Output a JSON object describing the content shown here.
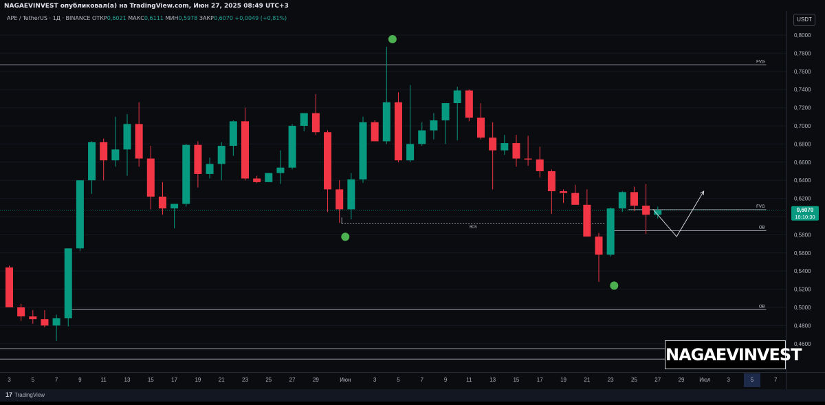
{
  "header": {
    "published_by": "NAGAEVINVEST опубликовал(а) на TradingView.com, Июн 27, 2025 08:49 UTC+3"
  },
  "symbol_line": {
    "title": "APE / TetherUS · 1Д · BINANCE",
    "open_label": "ОТКР",
    "open": "0,6021",
    "high_label": "МАКС",
    "high": "0,6111",
    "low_label": "МИН",
    "low": "0,5978",
    "close_label": "ЗАКР",
    "close": "0,6070",
    "change": "+0,0049 (+0,81%)"
  },
  "currency_button": "USDT",
  "price_badge": {
    "price": "0,6070",
    "timer": "18:10:30",
    "color": "#089981"
  },
  "watermark": "NAGAEVINVEST",
  "footer": {
    "brand_mark": "17",
    "brand": "TradingView"
  },
  "colors": {
    "up": "#089981",
    "down": "#f23645",
    "marker": "#4caf50",
    "background": "#0b0c10"
  },
  "chart_data": {
    "type": "candlestick",
    "ylim": [
      0.44,
      0.82
    ],
    "y_ticks": [
      0.46,
      0.48,
      0.5,
      0.52,
      0.54,
      0.56,
      0.58,
      0.6,
      0.62,
      0.64,
      0.66,
      0.68,
      0.7,
      0.72,
      0.74,
      0.76,
      0.78,
      0.8
    ],
    "y_tick_labels": [
      "0,4600",
      "0,4800",
      "0,5000",
      "0,5200",
      "0,5400",
      "0,5600",
      "0,5800",
      "0,6000",
      "0,6200",
      "0,6400",
      "0,6600",
      "0,6800",
      "0,7000",
      "0,7200",
      "0,7400",
      "0,7600",
      "0,7800",
      "0,8000"
    ],
    "x_tick_labels": [
      "3",
      "5",
      "7",
      "9",
      "11",
      "13",
      "15",
      "17",
      "19",
      "21",
      "23",
      "25",
      "27",
      "29",
      "Июн",
      "3",
      "5",
      "7",
      "9",
      "11",
      "13",
      "15",
      "17",
      "19",
      "21",
      "23",
      "25",
      "27",
      "29",
      "Июл",
      "3",
      "5",
      "7"
    ],
    "x_tick_index": [
      0,
      2,
      4,
      6,
      8,
      10,
      12,
      14,
      16,
      18,
      20,
      22,
      24,
      26,
      28.5,
      31,
      33,
      35,
      37,
      39,
      41,
      43,
      45,
      47,
      49,
      51,
      53,
      55,
      57,
      59,
      61,
      63,
      65
    ],
    "highlighted_x_label": "5",
    "candles": [
      {
        "o": 0.544,
        "h": 0.546,
        "l": 0.5,
        "c": 0.5
      },
      {
        "o": 0.5,
        "h": 0.504,
        "l": 0.485,
        "c": 0.49
      },
      {
        "o": 0.49,
        "h": 0.497,
        "l": 0.482,
        "c": 0.487
      },
      {
        "o": 0.487,
        "h": 0.497,
        "l": 0.478,
        "c": 0.48
      },
      {
        "o": 0.48,
        "h": 0.492,
        "l": 0.463,
        "c": 0.488
      },
      {
        "o": 0.488,
        "h": 0.505,
        "l": 0.479,
        "c": 0.565
      },
      {
        "o": 0.565,
        "h": 0.573,
        "l": 0.562,
        "c": 0.64
      },
      {
        "o": 0.64,
        "h": 0.683,
        "l": 0.625,
        "c": 0.682
      },
      {
        "o": 0.682,
        "h": 0.686,
        "l": 0.64,
        "c": 0.662
      },
      {
        "o": 0.662,
        "h": 0.71,
        "l": 0.655,
        "c": 0.674
      },
      {
        "o": 0.674,
        "h": 0.713,
        "l": 0.645,
        "c": 0.702
      },
      {
        "o": 0.702,
        "h": 0.726,
        "l": 0.655,
        "c": 0.664
      },
      {
        "o": 0.664,
        "h": 0.678,
        "l": 0.608,
        "c": 0.622
      },
      {
        "o": 0.622,
        "h": 0.638,
        "l": 0.602,
        "c": 0.609
      },
      {
        "o": 0.609,
        "h": 0.613,
        "l": 0.587,
        "c": 0.614
      },
      {
        "o": 0.614,
        "h": 0.68,
        "l": 0.611,
        "c": 0.679
      },
      {
        "o": 0.679,
        "h": 0.683,
        "l": 0.632,
        "c": 0.647
      },
      {
        "o": 0.647,
        "h": 0.665,
        "l": 0.642,
        "c": 0.658
      },
      {
        "o": 0.658,
        "h": 0.682,
        "l": 0.64,
        "c": 0.678
      },
      {
        "o": 0.678,
        "h": 0.706,
        "l": 0.667,
        "c": 0.705
      },
      {
        "o": 0.705,
        "h": 0.72,
        "l": 0.64,
        "c": 0.642
      },
      {
        "o": 0.642,
        "h": 0.645,
        "l": 0.637,
        "c": 0.638
      },
      {
        "o": 0.638,
        "h": 0.648,
        "l": 0.64,
        "c": 0.648
      },
      {
        "o": 0.648,
        "h": 0.673,
        "l": 0.636,
        "c": 0.654
      },
      {
        "o": 0.654,
        "h": 0.702,
        "l": 0.652,
        "c": 0.7
      },
      {
        "o": 0.7,
        "h": 0.713,
        "l": 0.694,
        "c": 0.714
      },
      {
        "o": 0.714,
        "h": 0.735,
        "l": 0.69,
        "c": 0.693
      },
      {
        "o": 0.693,
        "h": 0.695,
        "l": 0.605,
        "c": 0.63
      },
      {
        "o": 0.63,
        "h": 0.64,
        "l": 0.593,
        "c": 0.608
      },
      {
        "o": 0.608,
        "h": 0.648,
        "l": 0.597,
        "c": 0.641
      },
      {
        "o": 0.641,
        "h": 0.71,
        "l": 0.637,
        "c": 0.704
      },
      {
        "o": 0.704,
        "h": 0.706,
        "l": 0.687,
        "c": 0.683
      },
      {
        "o": 0.683,
        "h": 0.787,
        "l": 0.68,
        "c": 0.726
      },
      {
        "o": 0.726,
        "h": 0.737,
        "l": 0.66,
        "c": 0.662
      },
      {
        "o": 0.662,
        "h": 0.745,
        "l": 0.66,
        "c": 0.68
      },
      {
        "o": 0.68,
        "h": 0.704,
        "l": 0.678,
        "c": 0.695
      },
      {
        "o": 0.695,
        "h": 0.714,
        "l": 0.685,
        "c": 0.706
      },
      {
        "o": 0.706,
        "h": 0.725,
        "l": 0.68,
        "c": 0.725
      },
      {
        "o": 0.725,
        "h": 0.743,
        "l": 0.684,
        "c": 0.739
      },
      {
        "o": 0.739,
        "h": 0.74,
        "l": 0.705,
        "c": 0.709
      },
      {
        "o": 0.709,
        "h": 0.725,
        "l": 0.685,
        "c": 0.687
      },
      {
        "o": 0.687,
        "h": 0.704,
        "l": 0.63,
        "c": 0.673
      },
      {
        "o": 0.673,
        "h": 0.69,
        "l": 0.668,
        "c": 0.681
      },
      {
        "o": 0.681,
        "h": 0.69,
        "l": 0.655,
        "c": 0.664
      },
      {
        "o": 0.664,
        "h": 0.689,
        "l": 0.656,
        "c": 0.663
      },
      {
        "o": 0.663,
        "h": 0.677,
        "l": 0.643,
        "c": 0.65
      },
      {
        "o": 0.65,
        "h": 0.652,
        "l": 0.603,
        "c": 0.628
      },
      {
        "o": 0.628,
        "h": 0.63,
        "l": 0.615,
        "c": 0.626
      },
      {
        "o": 0.626,
        "h": 0.635,
        "l": 0.618,
        "c": 0.613
      },
      {
        "o": 0.613,
        "h": 0.63,
        "l": 0.59,
        "c": 0.578
      },
      {
        "o": 0.578,
        "h": 0.582,
        "l": 0.528,
        "c": 0.558
      },
      {
        "o": 0.558,
        "h": 0.61,
        "l": 0.556,
        "c": 0.609
      },
      {
        "o": 0.609,
        "h": 0.628,
        "l": 0.605,
        "c": 0.627
      },
      {
        "o": 0.627,
        "h": 0.633,
        "l": 0.606,
        "c": 0.612
      },
      {
        "o": 0.612,
        "h": 0.636,
        "l": 0.581,
        "c": 0.602
      },
      {
        "o": 0.602,
        "h": 0.611,
        "l": 0.598,
        "c": 0.607
      }
    ],
    "levels": [
      {
        "label": "FVG",
        "y": 0.7672,
        "x_from": -1,
        "x_to": 64.2,
        "color": "#9598a1",
        "style": "solid"
      },
      {
        "label": "FVG",
        "y": 0.6077,
        "x_from": 52.5,
        "x_to": 64.2,
        "color": "#9598a1",
        "style": "solid"
      },
      {
        "label": "OB",
        "y": 0.5845,
        "x_from": 51.3,
        "x_to": 64.2,
        "color": "#9598a1",
        "style": "solid"
      },
      {
        "label": "OB",
        "y": 0.4975,
        "x_from": 5.3,
        "x_to": 64.2,
        "color": "#9598a1",
        "style": "solid"
      },
      {
        "label": "FVG",
        "y": 0.4545,
        "x_from": -1,
        "x_to": 64.2,
        "color": "#9598a1",
        "style": "solid"
      },
      {
        "label": "FVG",
        "y": 0.443,
        "x_from": -1,
        "x_to": 64.2,
        "color": "#9598a1",
        "style": "solid"
      }
    ],
    "bos": {
      "label": "BOS",
      "y": 0.592,
      "x_from": 28.2,
      "x_to": 50.5
    },
    "current_price_line": 0.607,
    "markers": [
      {
        "x": 32.5,
        "y": 0.7955
      },
      {
        "x": 28.5,
        "y": 0.5777
      },
      {
        "x": 51.3,
        "y": 0.524
      }
    ],
    "projection_path": [
      [
        54.6,
        0.608
      ],
      [
        56.6,
        0.578
      ],
      [
        58.9,
        0.628
      ]
    ]
  }
}
